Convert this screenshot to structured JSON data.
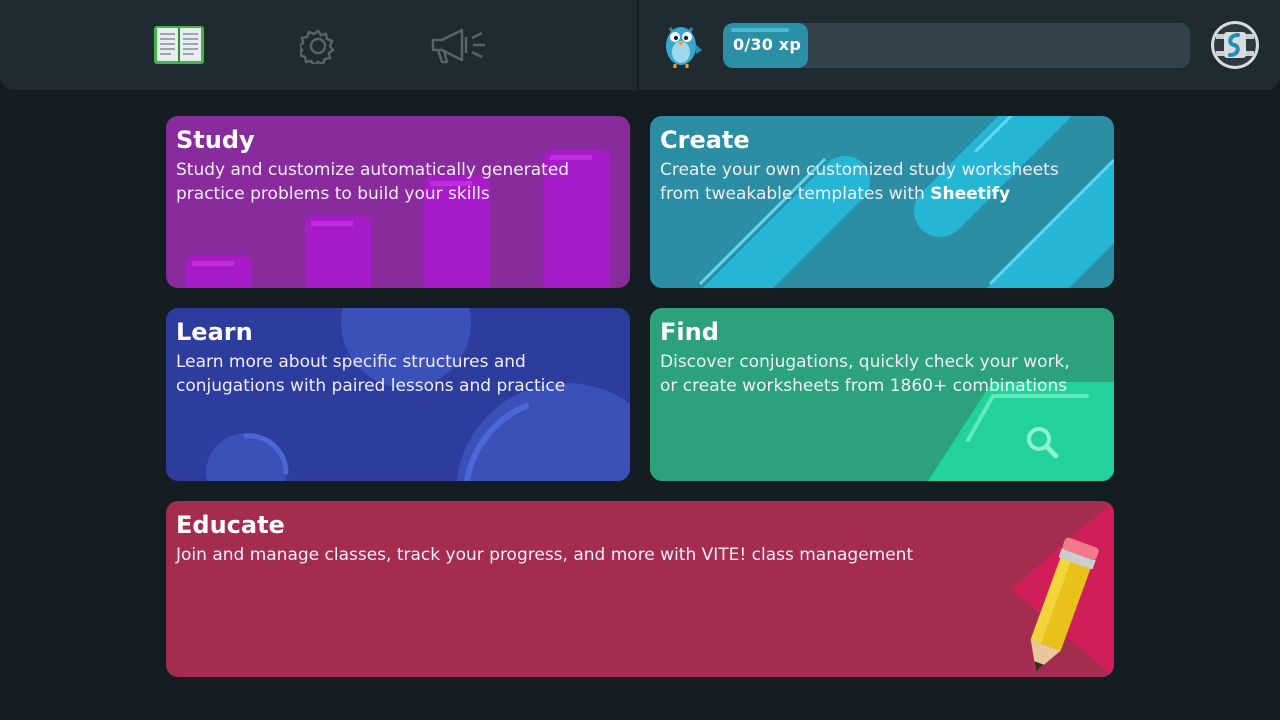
{
  "topbar": {
    "nav": [
      {
        "icon": "book-icon",
        "active": true
      },
      {
        "icon": "gear-icon",
        "active": false
      },
      {
        "icon": "megaphone-icon",
        "active": false
      }
    ],
    "xp": {
      "label": "0/30 xp",
      "current": 0,
      "goal": 30
    },
    "mascot_icon": "bird-mascot-icon",
    "avatar_icon": "profile-avatar-icon"
  },
  "cards": {
    "study": {
      "title": "Study",
      "description": "Study and customize automatically generated practice problems to build your skills",
      "color": "#8a2b9d"
    },
    "create": {
      "title": "Create",
      "description_before": "Create your own customized study worksheets from tweakable templates with ",
      "description_bold": "Sheetify",
      "color": "#2c8ea4"
    },
    "learn": {
      "title": "Learn",
      "description": "Learn more about specific structures and conjugations with paired lessons and practice",
      "color": "#2c3d9d"
    },
    "find": {
      "title": "Find",
      "description": "Discover conjugations, quickly check your work, or create worksheets from 1860+ combinations",
      "color": "#2ba27d"
    },
    "educate": {
      "title": "Educate",
      "description": "Join and manage classes, track your progress, and more with VITE! class management",
      "color": "#a42c4e"
    }
  },
  "colors": {
    "background": "#141d22",
    "topbar": "#1f2b31",
    "accent_green": "#3fb54a",
    "xp_fill": "#2b8fa6"
  }
}
